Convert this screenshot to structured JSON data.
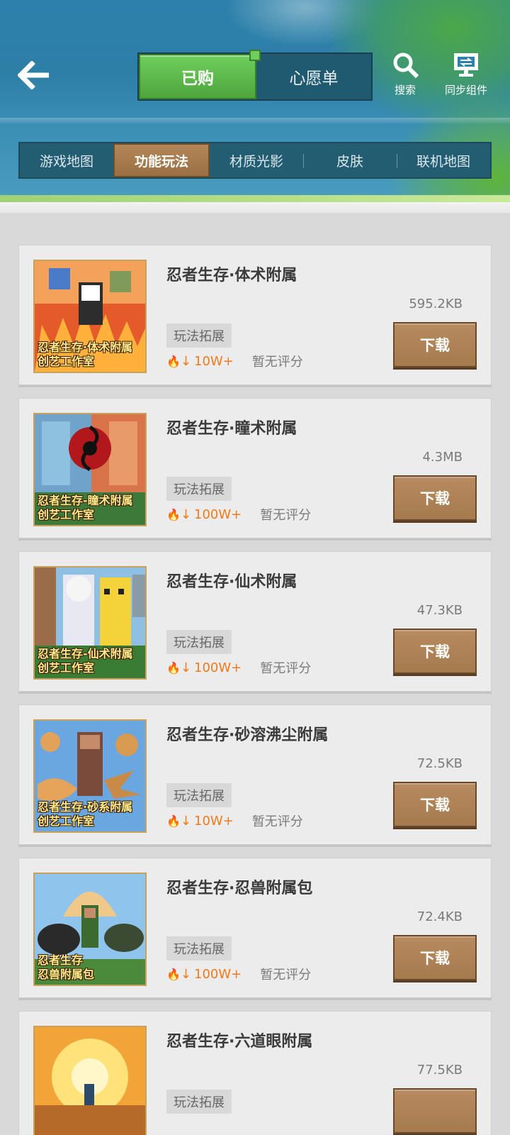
{
  "header": {
    "tabs": [
      {
        "label": "已购",
        "active": true
      },
      {
        "label": "心愿单",
        "active": false
      }
    ],
    "actions": {
      "search": "搜索",
      "sync": "同步组件"
    }
  },
  "categories": [
    {
      "label": "游戏地图",
      "active": false
    },
    {
      "label": "功能玩法",
      "active": true
    },
    {
      "label": "材质光影",
      "active": false
    },
    {
      "label": "皮肤",
      "active": false
    },
    {
      "label": "联机地图",
      "active": false
    }
  ],
  "items": [
    {
      "title": "忍者生存·体术附属",
      "size": "595.2KB",
      "tag": "玩法拓展",
      "downloads": "10W+",
      "rating": "暂无评分",
      "button": "下载",
      "thumb_caption": "忍者生存·体术附属\n创艺工作室"
    },
    {
      "title": "忍者生存·瞳术附属",
      "size": "4.3MB",
      "tag": "玩法拓展",
      "downloads": "100W+",
      "rating": "暂无评分",
      "button": "下载",
      "thumb_caption": "忍者生存-瞳术附属\n创艺工作室"
    },
    {
      "title": "忍者生存·仙术附属",
      "size": "47.3KB",
      "tag": "玩法拓展",
      "downloads": "100W+",
      "rating": "暂无评分",
      "button": "下载",
      "thumb_caption": "忍者生存-仙术附属\n创艺工作室"
    },
    {
      "title": "忍者生存·砂溶沸尘附属",
      "size": "72.5KB",
      "tag": "玩法拓展",
      "downloads": "10W+",
      "rating": "暂无评分",
      "button": "下载",
      "thumb_caption": "忍者生存·砂系附属\n创艺工作室"
    },
    {
      "title": "忍者生存·忍兽附属包",
      "size": "72.4KB",
      "tag": "玩法拓展",
      "downloads": "100W+",
      "rating": "暂无评分",
      "button": "下载",
      "thumb_caption": "忍者生存\n忍兽附属包"
    },
    {
      "title": "忍者生存·六道眼附属",
      "size": "77.5KB",
      "tag": "玩法拓展",
      "downloads": "",
      "rating": "",
      "button": "",
      "thumb_caption": ""
    }
  ],
  "colors": {
    "header_blue": "#2c80ab",
    "active_tab_green": "#4ea53c",
    "active_category_brown": "#9a6f43",
    "download_button": "#a57a4d",
    "hot_orange": "#f07a1a"
  }
}
